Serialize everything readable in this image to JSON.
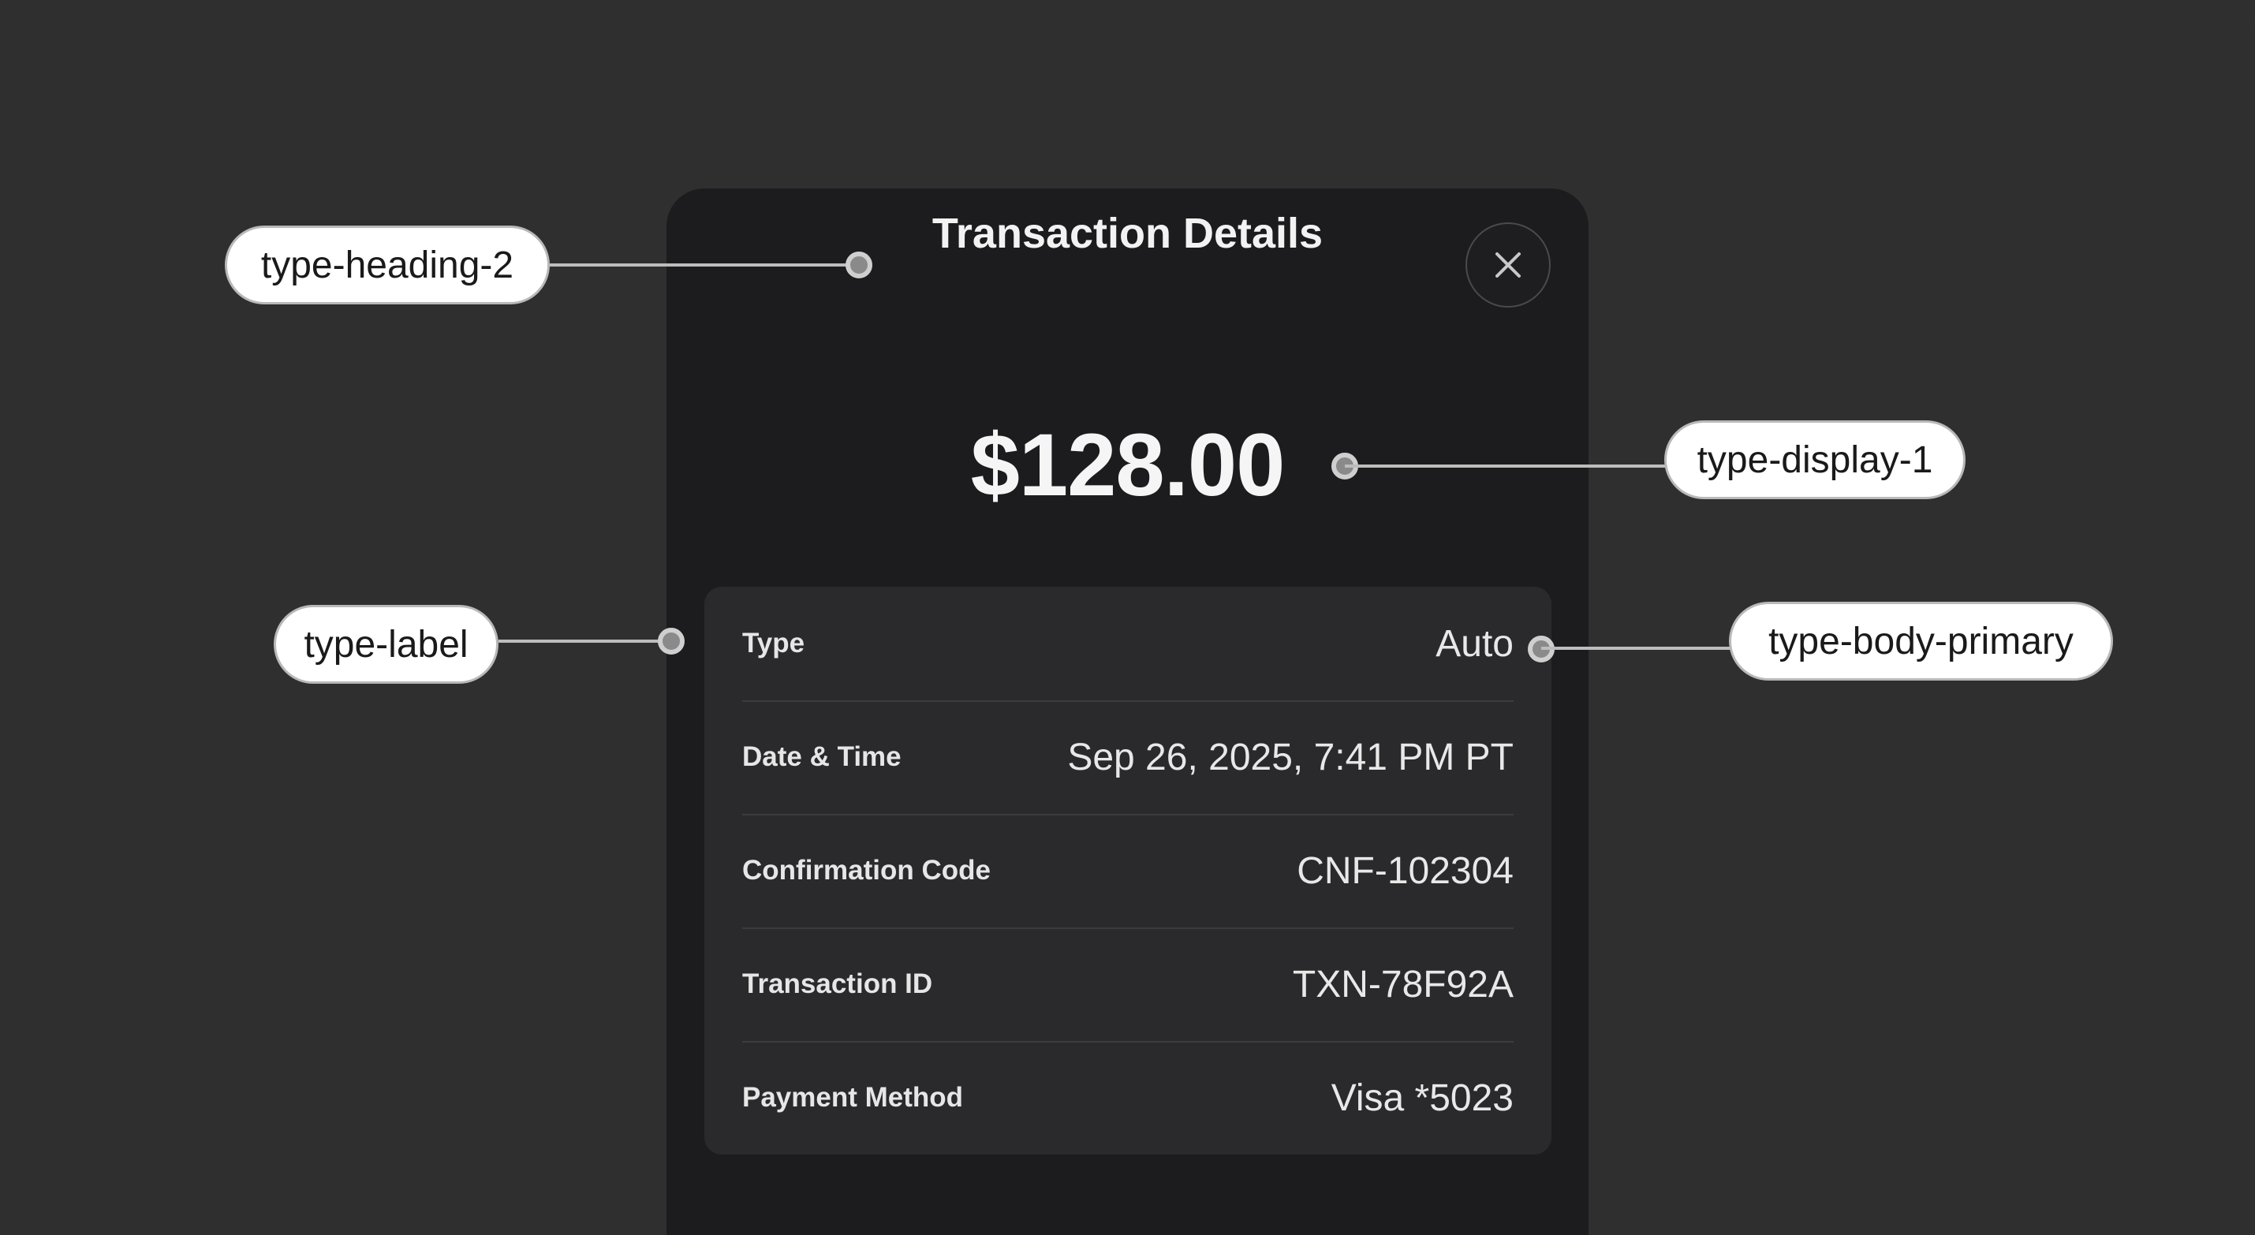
{
  "modal": {
    "title": "Transaction Details",
    "amount": "$128.00",
    "close_icon": "close-icon"
  },
  "details": [
    {
      "label": "Type",
      "value": "Auto"
    },
    {
      "label": "Date & Time",
      "value": "Sep 26, 2025, 7:41 PM PT"
    },
    {
      "label": "Confirmation Code",
      "value": "CNF-102304"
    },
    {
      "label": "Transaction ID",
      "value": "TXN-78F92A"
    },
    {
      "label": "Payment Method",
      "value": "Visa *5023"
    }
  ],
  "annotations": {
    "heading": "type-heading-2",
    "display": "type-display-1",
    "label": "type-label",
    "body": "type-body-primary"
  },
  "colors": {
    "background": "#2f2f30",
    "modal": "#1c1c1e",
    "details_card": "#2a2a2c",
    "text": "#f2f2f2",
    "annotation_pill": "#ffffff"
  }
}
